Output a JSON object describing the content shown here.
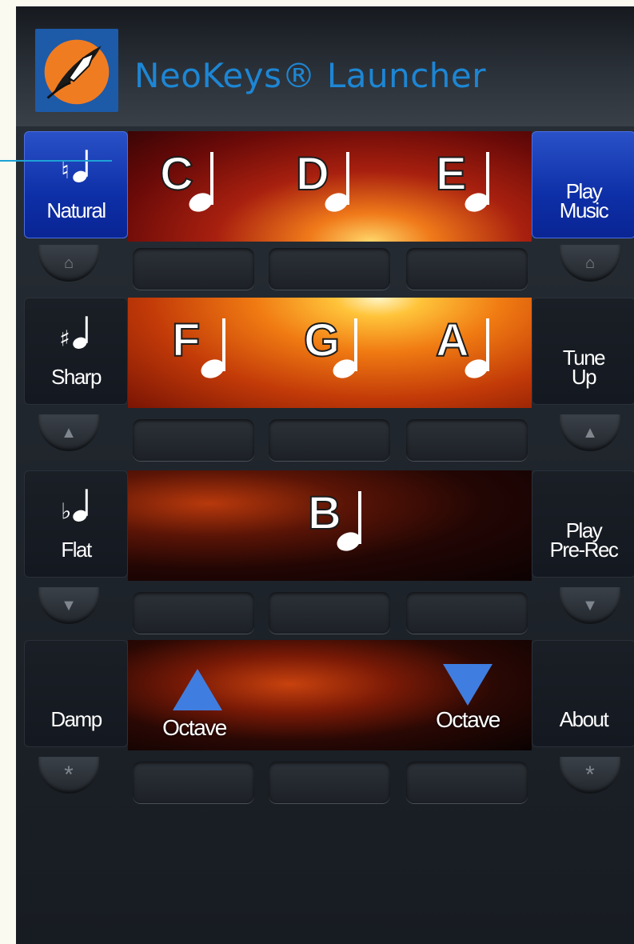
{
  "app": {
    "title": "NeoKeys® Launcher"
  },
  "colors": {
    "accent_blue": "#1d86d4",
    "button_blue": "#0d2fa7",
    "logo_orange": "#f07c22"
  },
  "rows": [
    {
      "left": {
        "label": "Natural",
        "icon": "natural-note-icon"
      },
      "right": {
        "label": "Play\nMusic"
      },
      "notes": [
        "C",
        "D",
        "E"
      ],
      "left_knob": "home-icon",
      "right_knob": "home-icon"
    },
    {
      "left": {
        "label": "Sharp",
        "icon": "sharp-note-icon"
      },
      "right": {
        "label": "Tune\nUp"
      },
      "notes": [
        "F",
        "G",
        "A"
      ],
      "left_knob": "up-triangle-icon",
      "right_knob": "up-triangle-icon"
    },
    {
      "left": {
        "label": "Flat",
        "icon": "flat-note-icon"
      },
      "right": {
        "label": "Play\nPre-Rec"
      },
      "notes": [
        "B"
      ],
      "left_knob": "down-triangle-icon",
      "right_knob": "down-triangle-icon"
    },
    {
      "left": {
        "label": "Damp"
      },
      "right": {
        "label": "About"
      },
      "octave_up": "Octave",
      "octave_down": "Octave",
      "left_knob": "asterisk-icon",
      "right_knob": "asterisk-icon"
    }
  ]
}
